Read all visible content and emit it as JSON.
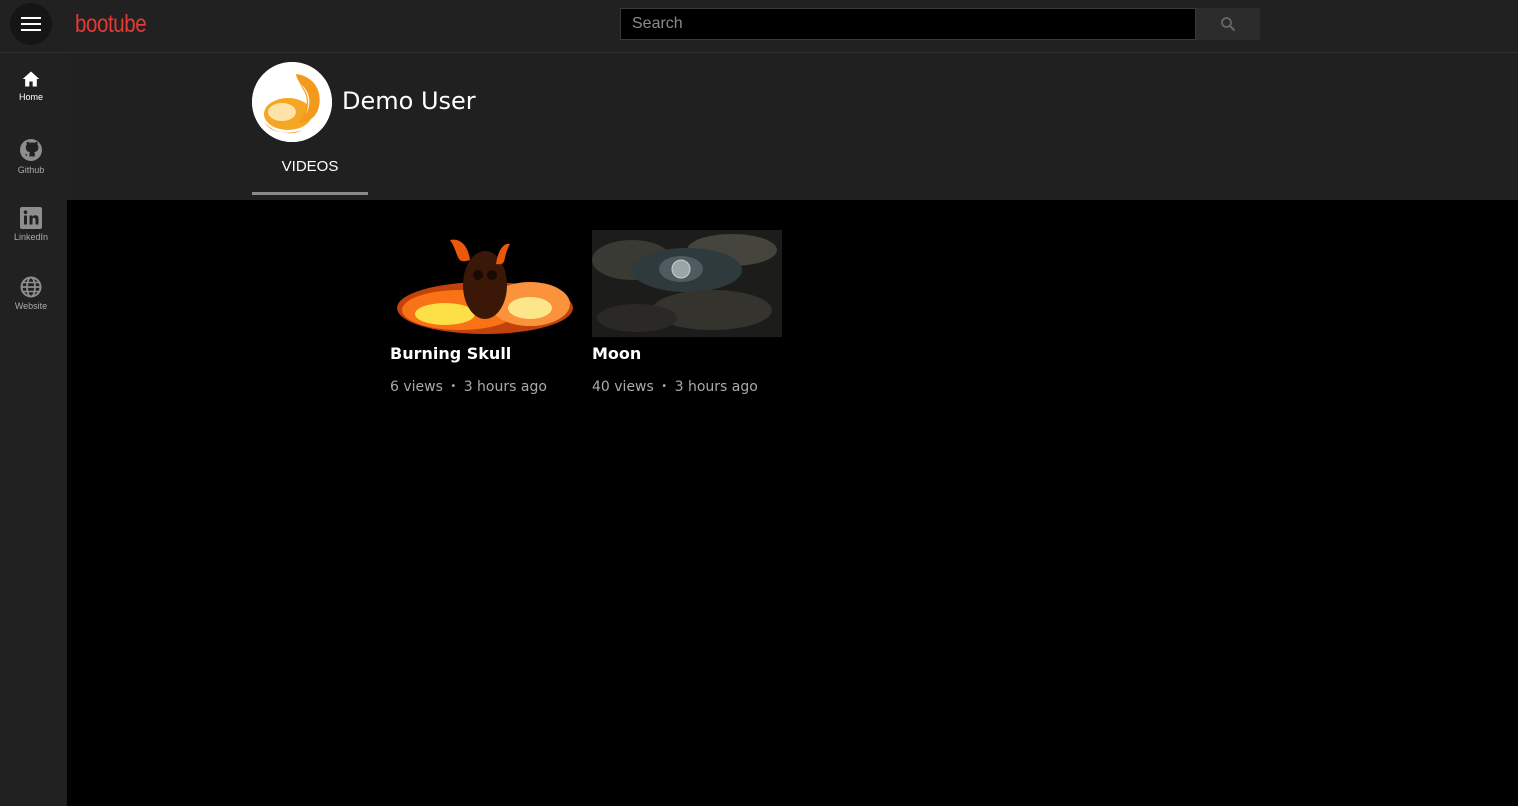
{
  "app": {
    "logo": "bootube"
  },
  "search": {
    "placeholder": "Search",
    "icon": "search-icon"
  },
  "sidebar": {
    "items": [
      {
        "label": "Home",
        "icon": "home-icon",
        "active": true
      },
      {
        "label": "Github",
        "icon": "github-icon",
        "active": false
      },
      {
        "label": "LinkedIn",
        "icon": "linkedin-icon",
        "active": false
      },
      {
        "label": "Website",
        "icon": "globe-icon",
        "active": false
      }
    ]
  },
  "channel": {
    "name": "Demo User",
    "tabs": [
      {
        "label": "VIDEOS",
        "active": true
      }
    ]
  },
  "videos": [
    {
      "title": "Burning Skull",
      "views": "6 views",
      "separator": "•",
      "age": "3 hours ago"
    },
    {
      "title": "Moon",
      "views": "40 views",
      "separator": "•",
      "age": "3 hours ago"
    }
  ],
  "colors": {
    "brand": "#e53935",
    "background": "#000000",
    "surface": "#212121"
  }
}
